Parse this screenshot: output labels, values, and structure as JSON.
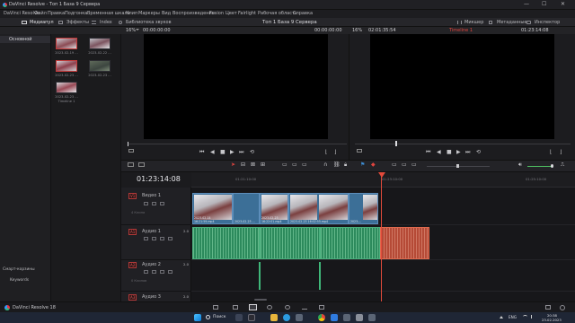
{
  "window": {
    "app_title": "DaVinci Resolve - Топ 1 База 9 Сервера",
    "controls": [
      "—",
      "☐",
      "✕"
    ]
  },
  "menu": {
    "items": [
      "DaVinci Resolve",
      "Файл",
      "Правка",
      "Подгонка",
      "Временная шкала",
      "Клип",
      "Маркеры",
      "Вид",
      "Воспроизведение",
      "Fusion",
      "Цвет",
      "Fairlight",
      "Рабочая область",
      "Справка"
    ]
  },
  "toolbar": {
    "media_pool": "Медиапул",
    "effects": "Эффекты",
    "index": "Index",
    "sound_library": "Библиотека звуков",
    "project_title": "Топ 1 База 9 Сервера",
    "mixer": "Микшер",
    "metadata": "Метаданные",
    "inspector": "Инспектор"
  },
  "source_viewer": {
    "zoom": "16%",
    "timecode_left": "00:00:00:00",
    "timecode_right": "00:00:00:00"
  },
  "program_viewer": {
    "zoom": "16%",
    "duration": "02:01:35:54",
    "timeline_name": "Timeline 1",
    "timecode": "01:23:14:08"
  },
  "bins": {
    "selected": "Основной",
    "smart_bins_label": "Смарт-корзины",
    "keywords": "Keywords"
  },
  "media_pool": {
    "clips": [
      {
        "name": "2023-02-19 ...",
        "selected": true
      },
      {
        "name": "2023-02-22 ...",
        "selected": false
      },
      {
        "name": "2023-02-23 ...",
        "selected": true
      },
      {
        "name": "2023-02-23 ...",
        "selected": false
      },
      {
        "name": "2023-02-23 ...",
        "selected": false
      },
      {
        "name": "Timeline 1",
        "selected": false
      }
    ]
  },
  "timeline": {
    "timecode": "01:23:14:08",
    "ruler_marks": [
      "01:21:10:00",
      "01:23:10:00",
      "01:25:10:00"
    ],
    "tracks": [
      {
        "tag": "V1",
        "name": "Видео 1",
        "info": "4 Клипа"
      },
      {
        "tag": "A1",
        "name": "Аудио 1",
        "info": "",
        "channels": "2.0"
      },
      {
        "tag": "A2",
        "name": "Аудио 2",
        "info": "0 Клипов",
        "channels": "2.0"
      },
      {
        "tag": "A3",
        "name": "Аудио 3",
        "info": "",
        "channels": "2.0"
      }
    ],
    "video_clips": [
      "2023-02-14 16:21:59.mp4",
      "2023-02-23 ...",
      "2023-02-23 16:22:01.mp4",
      "2023-02-23 16:02:55.mp4",
      "2023-..."
    ]
  },
  "statusbar": {
    "app_name": "DaVinci Resolve 18"
  },
  "taskbar": {
    "search": "Поиск",
    "lang": "ENG",
    "time": "20:38",
    "date": "23.02.2023"
  },
  "colors": {
    "accent_red": "#e0443e",
    "video_clip": "#3c6f97",
    "audio_clip": "#2c8a5c",
    "playhead": "#e24a3b"
  }
}
